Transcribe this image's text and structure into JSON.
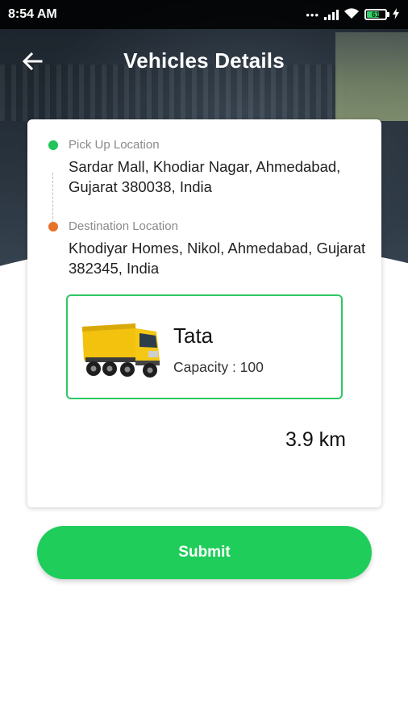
{
  "status_bar": {
    "time": "8:54 AM",
    "battery_level": "61",
    "icons": [
      "notification-dots-icon",
      "signal-icon",
      "wifi-icon",
      "battery-icon",
      "charging-icon"
    ]
  },
  "app_bar": {
    "title": "Vehicles Details",
    "back_icon": "arrow-left-icon"
  },
  "route": {
    "pickup": {
      "label": "Pick Up Location",
      "address": "Sardar Mall, Khodiar Nagar, Ahmedabad, Gujarat 380038, India",
      "dot_color": "#20c45a"
    },
    "destination": {
      "label": "Destination Location",
      "address": "Khodiyar Homes, Nikol, Ahmedabad, Gujarat 382345, India",
      "dot_color": "#e8722a"
    }
  },
  "vehicle": {
    "name": "Tata",
    "capacity": "Capacity : 100",
    "image_icon": "dump-truck-icon",
    "border_color": "#2ec765"
  },
  "distance": "3.9 km",
  "submit": {
    "label": "Submit",
    "color": "#1fce5a"
  }
}
